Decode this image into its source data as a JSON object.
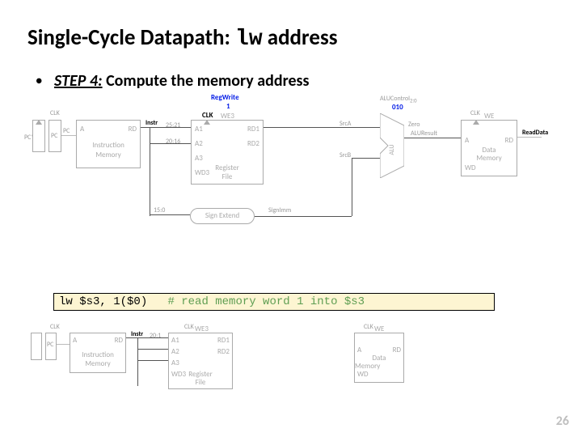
{
  "title": {
    "pre": "Single-Cycle Datapath: ",
    "mono": "lw",
    "post": " address"
  },
  "bullet": {
    "step_label": "STEP 4:",
    "rest": " Compute the memory address"
  },
  "code": {
    "inst": "lw $s3, 1($0)",
    "cmt": "# read memory word 1 into $s3"
  },
  "signals": {
    "regwrite": "RegWrite",
    "regwrite_val": "1",
    "aluctrl": "ALUControl",
    "aluctrl_sub": "2:0",
    "aluctrl_val": "010",
    "clk": "CLK",
    "pc": "PC",
    "instr": "Instr",
    "signimm": "SignImm",
    "srcA": "SrcA",
    "srcB": "SrcB",
    "zero": "Zero",
    "aluresult": "ALUResult",
    "readdata": "ReadData"
  },
  "blocks": {
    "pc": "PC",
    "imem1": "Instruction",
    "imem2": "Memory",
    "rf1": "Register",
    "rf2": "File",
    "signext": "Sign Extend",
    "alu": "ALU",
    "dmem1": "Data",
    "dmem2": "Memory"
  },
  "ports": {
    "A": "A",
    "RD": "RD",
    "A1": "A1",
    "A2": "A2",
    "A3": "A3",
    "WD3": "WD3",
    "WE3": "WE3",
    "RD1": "RD1",
    "RD2": "RD2",
    "WE": "WE",
    "WD": "WD",
    "bits2521": "25:21",
    "bits2016": "20:16",
    "bits150": "15:0",
    "bits201": "20:1"
  },
  "pagenum": "26"
}
